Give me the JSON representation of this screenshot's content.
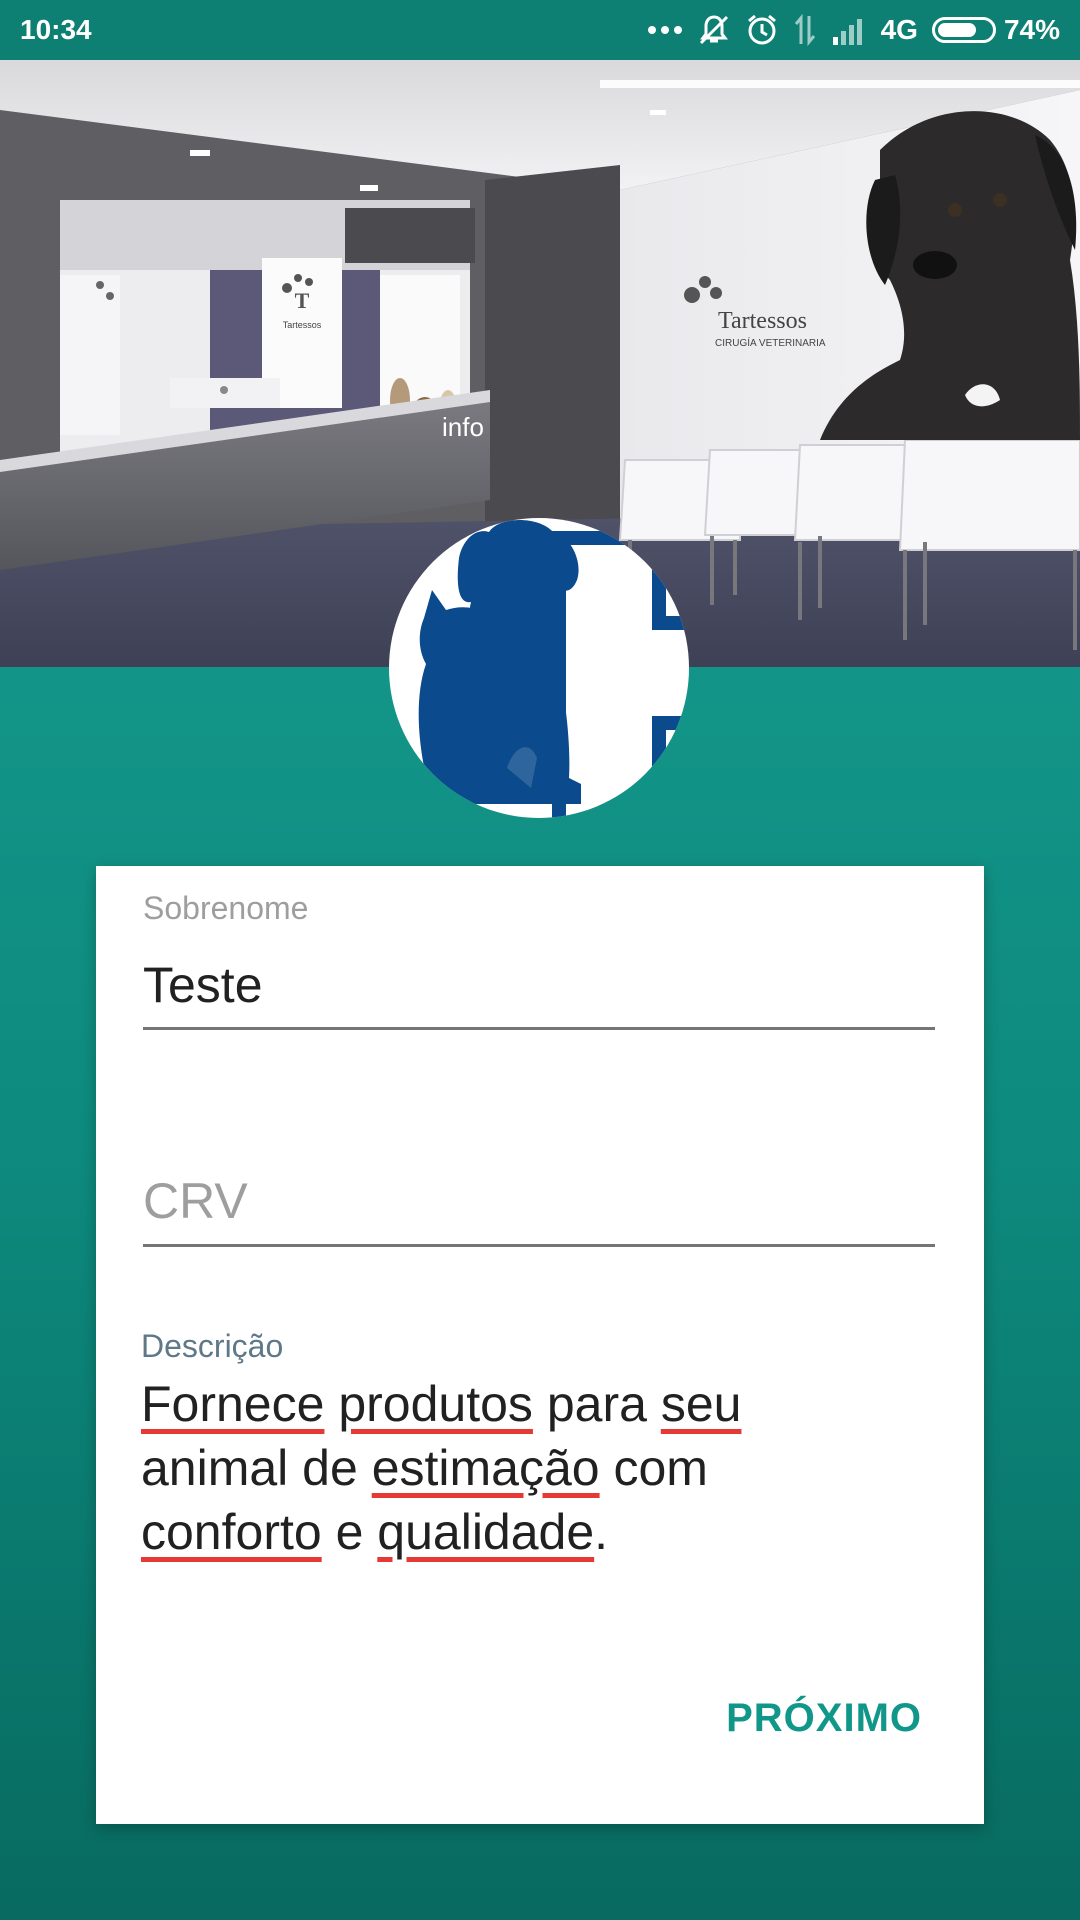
{
  "status_bar": {
    "time": "10:34",
    "network": "4G",
    "battery_percent": "74%",
    "battery_level": 0.74,
    "icons": [
      "more-dots-icon",
      "mute-icon",
      "alarm-icon",
      "data-arrows-icon",
      "signal-icon",
      "battery-icon"
    ]
  },
  "header": {
    "clinic_sign_name": "Tartessos",
    "clinic_sign_subtitle": "CIRUGÍA VETERINARIA",
    "desk_sign_name": "Tartessos",
    "info_label": "info"
  },
  "form": {
    "sobrenome": {
      "label": "Sobrenome",
      "value": "Teste"
    },
    "crv": {
      "placeholder": "CRV",
      "value": ""
    },
    "descricao": {
      "label": "Descrição",
      "words": [
        "Fornece",
        "produtos",
        "para",
        "seu",
        "animal de",
        "estimação",
        "com",
        "conforto",
        "e",
        "qualidade",
        "."
      ]
    },
    "next_label": "PRÓXIMO"
  },
  "colors": {
    "accent": "#11978a",
    "status_bar": "#0d7f73",
    "logo_blue": "#0b4a8c",
    "spell_underline": "#e53935"
  }
}
